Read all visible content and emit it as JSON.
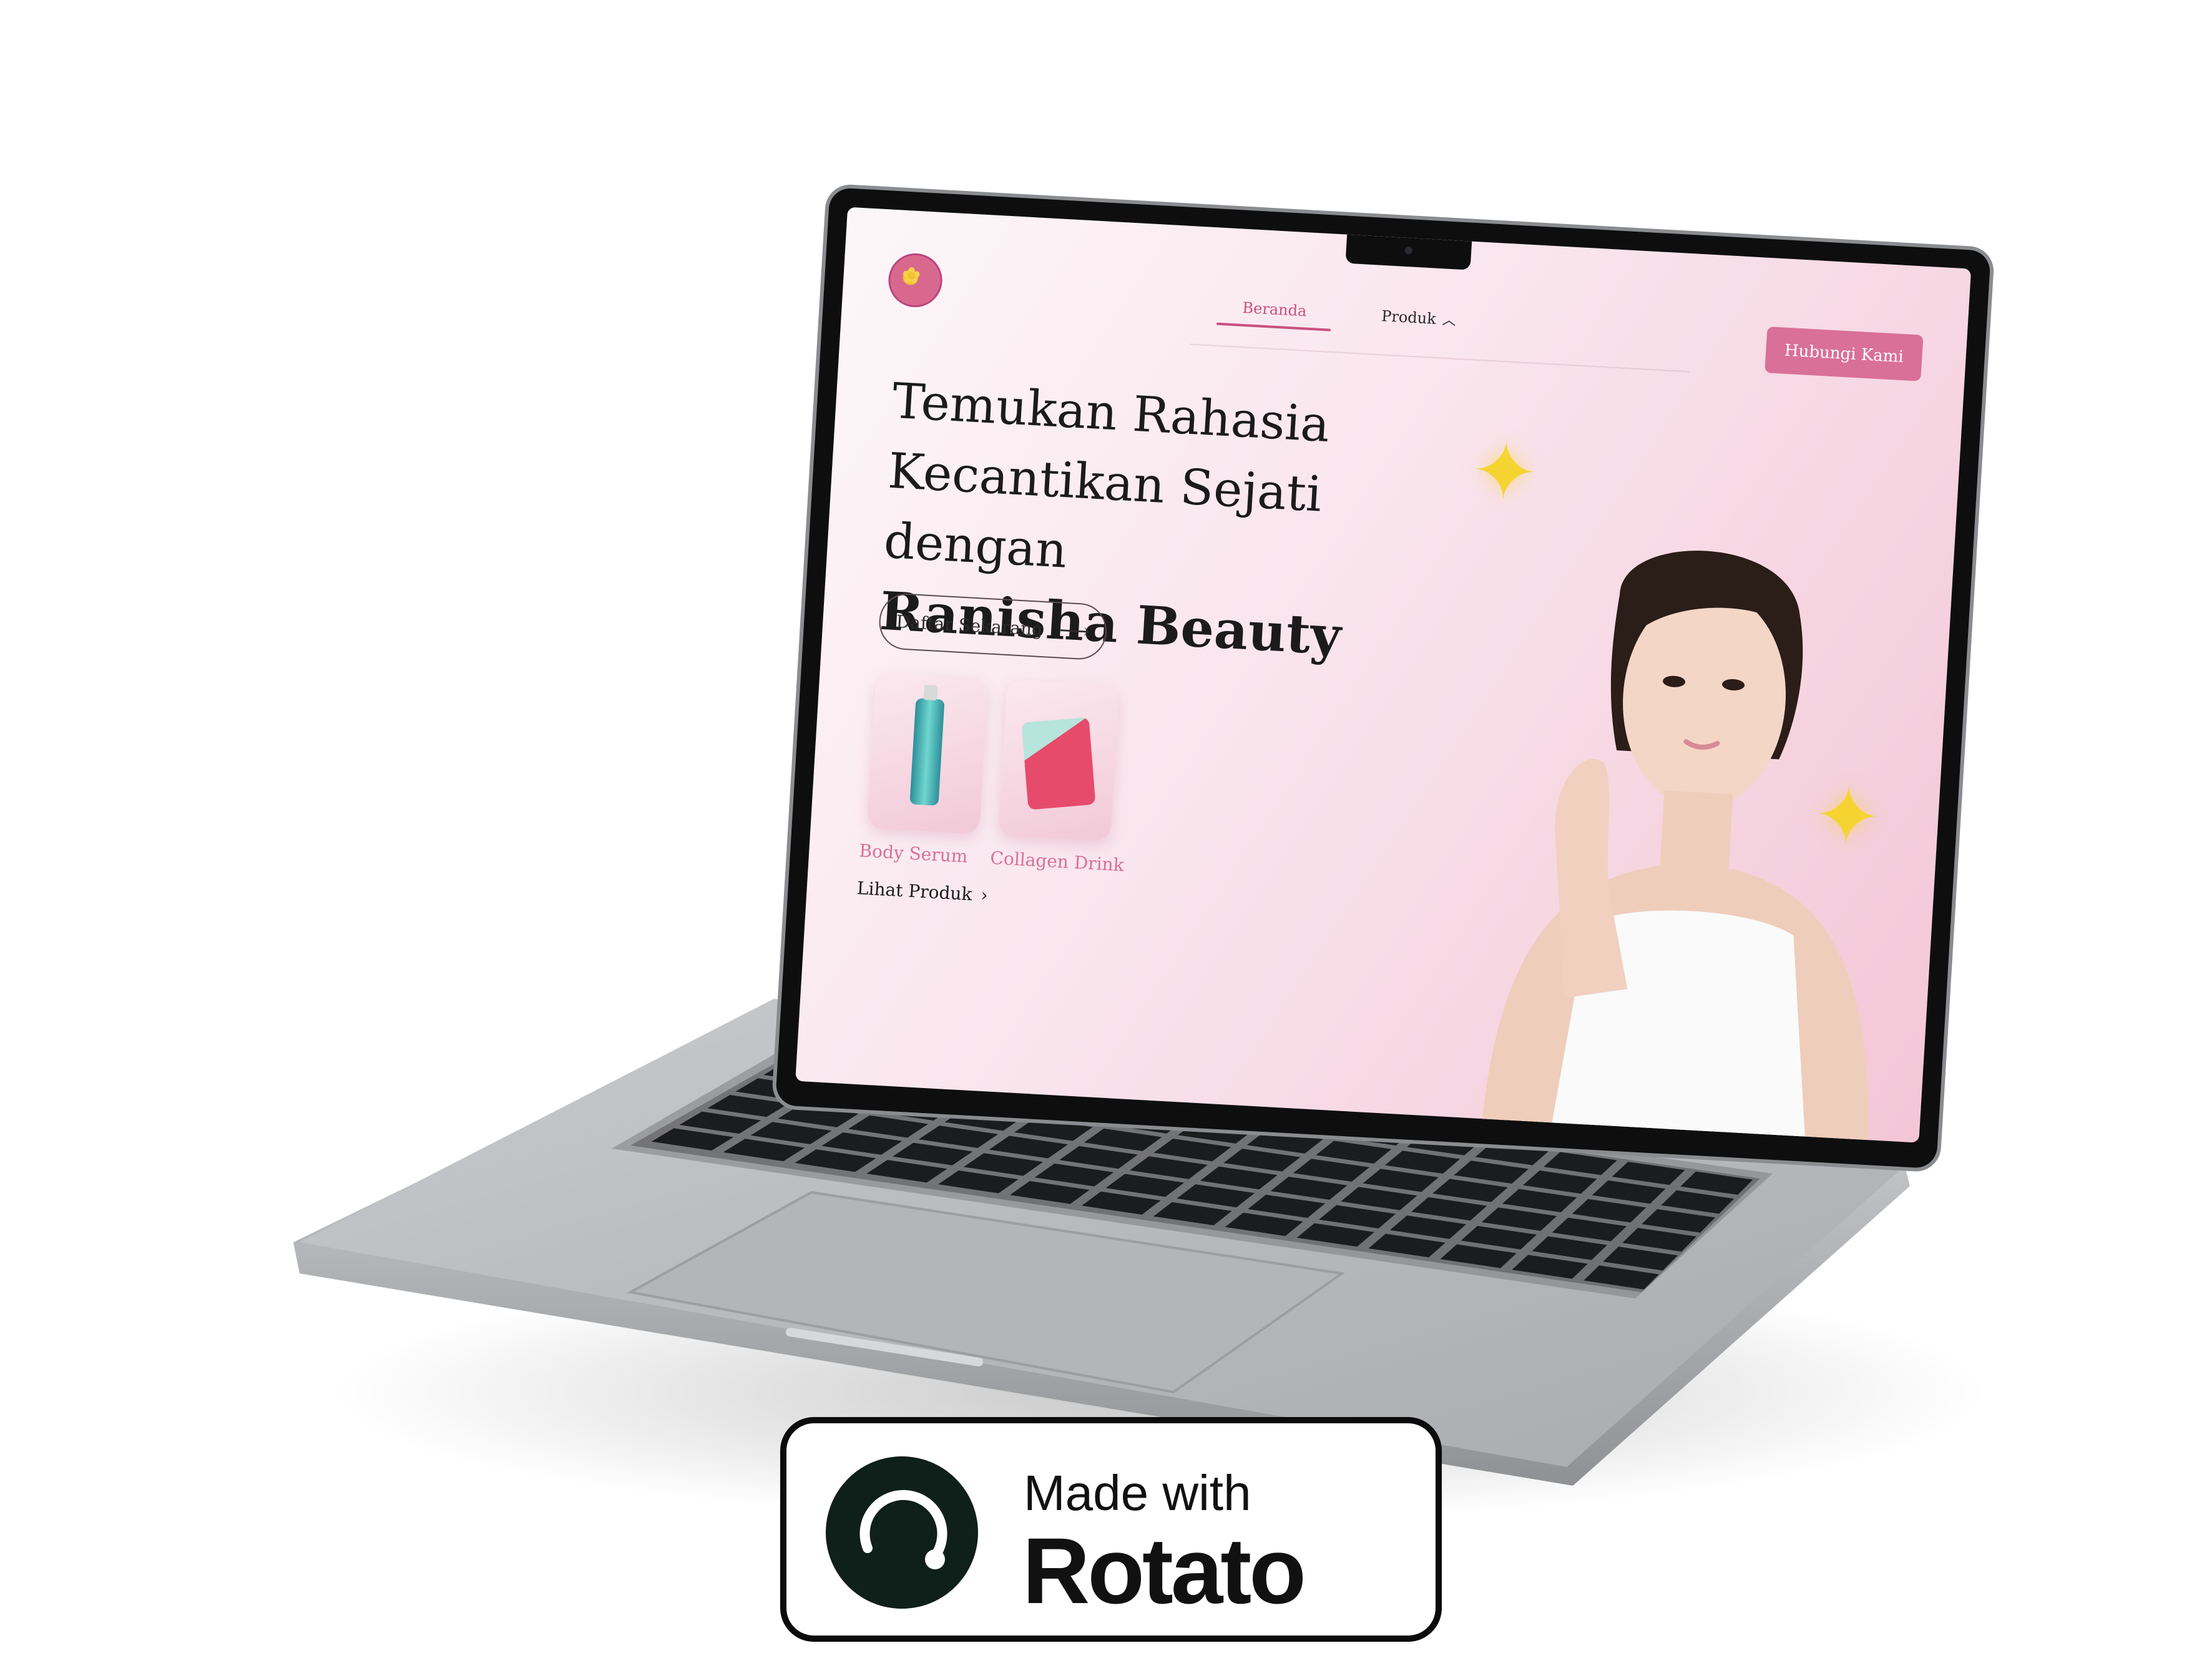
{
  "site": {
    "nav": {
      "home": "Beranda",
      "products": "Produk"
    },
    "contact_button": "Hubungi Kami",
    "hero": {
      "line1": "Temukan Rahasia",
      "line2": "Kecantikan Sejati dengan",
      "line3": "Ranisha Beauty"
    },
    "signup_button": "Daftar Sekarang",
    "products": [
      {
        "label": "Body Serum"
      },
      {
        "label": "Collagen Drink"
      }
    ],
    "see_products": "Lihat Produk"
  },
  "badge": {
    "small": "Made with",
    "big": "Rotato"
  },
  "colors": {
    "accent": "#d97098",
    "star": "#f5d432",
    "badge_dark": "#0f1f19"
  },
  "icons": [
    "chevron-up-icon",
    "arrow-right-icon",
    "chevron-right-icon",
    "star-icon",
    "rotato-logo-icon"
  ]
}
